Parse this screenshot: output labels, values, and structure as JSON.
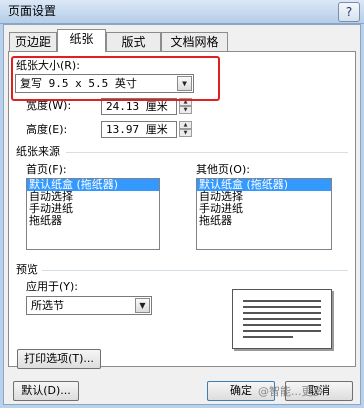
{
  "window": {
    "title": "页面设置",
    "help_label": "?"
  },
  "tabs": [
    {
      "label": "页边距",
      "active": false
    },
    {
      "label": "纸张",
      "active": true
    },
    {
      "label": "版式",
      "active": false
    },
    {
      "label": "文档网格",
      "active": false
    }
  ],
  "paper_size": {
    "label": "纸张大小(R):",
    "value": "复写 9.5 x 5.5 英寸",
    "width_label": "宽度(W):",
    "width_value": "24.13 厘米",
    "height_label": "高度(E):",
    "height_value": "13.97 厘米"
  },
  "paper_source": {
    "group_label": "纸张来源",
    "first_page_label": "首页(F):",
    "other_pages_label": "其他页(O):",
    "first_page_items": [
      "默认纸盒 (拖纸器)",
      "自动选择",
      "手动进纸",
      "拖纸器"
    ],
    "other_pages_items": [
      "默认纸盒 (拖纸器)",
      "自动选择",
      "手动进纸",
      "拖纸器"
    ],
    "selected_index": 0
  },
  "preview": {
    "group_label": "预览",
    "apply_to_label": "应用于(Y):",
    "apply_to_value": "所选节"
  },
  "buttons": {
    "print_options": "打印选项(T)...",
    "default": "默认(D)...",
    "ok": "确定",
    "cancel": "取消"
  },
  "watermark": "@智能...更多"
}
